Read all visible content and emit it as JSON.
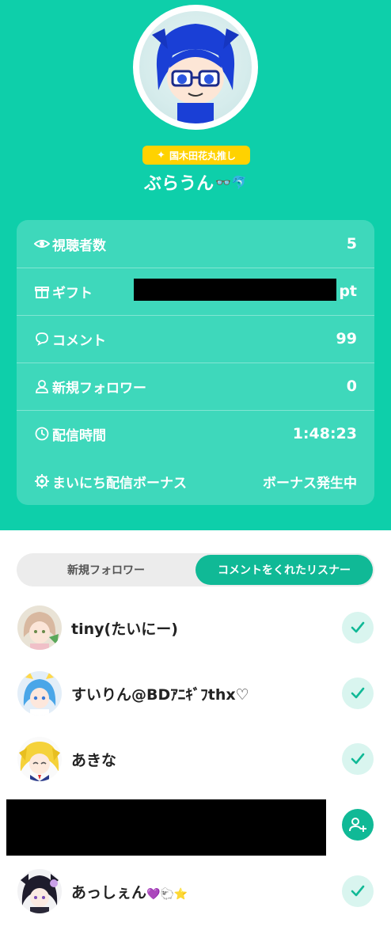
{
  "profile": {
    "badge_text": "国木田花丸推し",
    "username": "ぶらうん",
    "username_emoji": "👓🐬"
  },
  "stats": [
    {
      "label": "視聴者数",
      "value": "5",
      "icon": "eye-icon"
    },
    {
      "label": "ギフト",
      "value": "pt",
      "icon": "gift-icon"
    },
    {
      "label": "コメント",
      "value": "99",
      "icon": "comment-icon"
    },
    {
      "label": "新規フォロワー",
      "value": "0",
      "icon": "person-icon"
    },
    {
      "label": "配信時間",
      "value": "1:48:23",
      "icon": "clock-icon"
    },
    {
      "label": "まいにち配信ボーナス",
      "value": "ボーナス発生中",
      "icon": "bonus-gear-icon"
    }
  ],
  "tabs": {
    "new_followers": "新規フォロワー",
    "commenters": "コメントをくれたリスナー",
    "active": "commenters"
  },
  "listeners": [
    {
      "name": "tiny(たいにー)",
      "action": "followed"
    },
    {
      "name": "すいりん@BDｱﾆｷﾞﾌthx♡",
      "action": "followed"
    },
    {
      "name": "あきな",
      "action": "followed"
    },
    {
      "name": "",
      "action": "follow"
    },
    {
      "name": "あっしぇん",
      "name_emoji": "💜🐑⭐",
      "action": "followed"
    }
  ],
  "colors": {
    "brand": "#0ecfaa",
    "accent_dark": "#10b996",
    "badge": "#ffd200"
  }
}
